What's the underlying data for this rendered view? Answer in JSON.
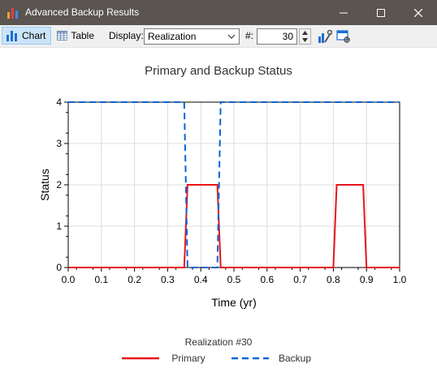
{
  "window": {
    "title": "Advanced Backup Results"
  },
  "toolbar": {
    "chart_label": "Chart",
    "table_label": "Table",
    "display_label": "Display:",
    "display_value": "Realization",
    "number_label": "#:",
    "number_value": "30"
  },
  "chart_data": {
    "type": "line",
    "title": "Primary and Backup Status",
    "xlabel": "Time (yr)",
    "ylabel": "Status",
    "xlim": [
      0.0,
      1.0
    ],
    "ylim": [
      0,
      4
    ],
    "xticks": [
      "0.0",
      "0.1",
      "0.2",
      "0.3",
      "0.4",
      "0.5",
      "0.6",
      "0.7",
      "0.8",
      "0.9",
      "1.0"
    ],
    "yticks": [
      "0",
      "1",
      "2",
      "3",
      "4"
    ],
    "grid": true,
    "legend_title": "Realization #30",
    "legend_position": "bottom",
    "series": [
      {
        "name": "Primary",
        "color": "#e8141c",
        "style": "solid",
        "x": [
          0.0,
          0.35,
          0.36,
          0.45,
          0.46,
          0.8,
          0.81,
          0.89,
          0.9,
          1.0
        ],
        "y": [
          0,
          0,
          2,
          2,
          0,
          0,
          2,
          2,
          0,
          0
        ]
      },
      {
        "name": "Backup",
        "color": "#0a64d8",
        "style": "dashed",
        "x": [
          0.0,
          0.35,
          0.36,
          0.45,
          0.46,
          1.0
        ],
        "y": [
          4,
          4,
          0,
          0,
          4,
          4
        ]
      }
    ]
  }
}
